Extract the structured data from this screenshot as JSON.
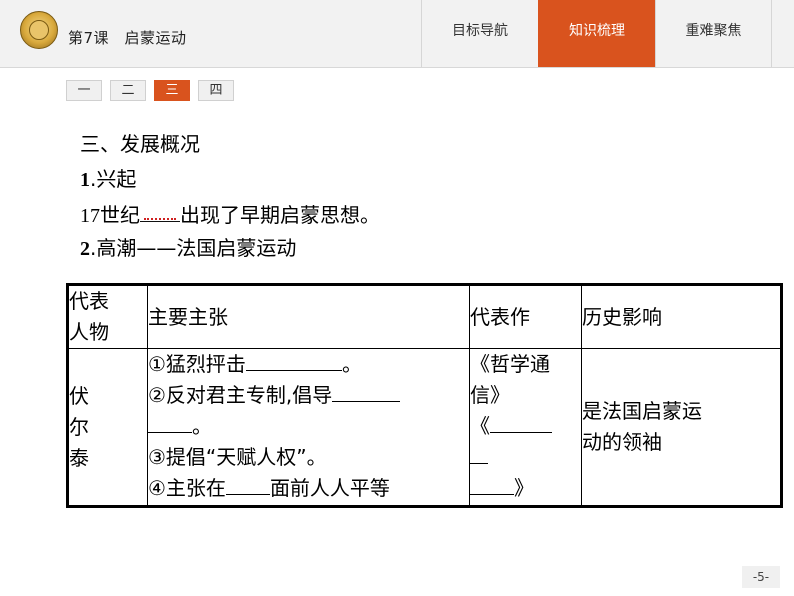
{
  "header": {
    "lesson_title": "第7课　启蒙运动",
    "nav_tabs": [
      {
        "label": "目标导航"
      },
      {
        "label": "知识梳理"
      },
      {
        "label": "重难聚焦"
      }
    ],
    "active_tab": "知识梳理",
    "accent_color": "#d9531e"
  },
  "section_tabs": [
    {
      "label": "一"
    },
    {
      "label": "二"
    },
    {
      "label": "三"
    },
    {
      "label": "四"
    }
  ],
  "content": {
    "heading": "三、发展概况",
    "sub1_num": "1",
    "sub1_text": ".兴起",
    "line1_prefix": "17世纪",
    "line1_suffix": "出现了早期启蒙思想。",
    "sub2_num": "2",
    "sub2_text": ".高潮——法国启蒙运动"
  },
  "table": {
    "headers": {
      "col1_line1": "代表",
      "col1_line2": "人物",
      "col2": "主要主张",
      "col3": "代表作",
      "col4": "历史影响"
    },
    "person_chars": [
      "伏",
      "尔",
      "泰"
    ],
    "claims": {
      "c1_prefix": "①猛烈抨击",
      "c1_suffix": "。",
      "c2_prefix": "②反对君主专制,倡导",
      "c2_cont_suffix": "。",
      "c3": "③提倡“天赋人权”。",
      "c4_prefix": "④主张在",
      "c4_suffix": "面前人人平等"
    },
    "works": {
      "w1_line1": "《哲学通",
      "w1_line2": "信》",
      "w2_open": "《",
      "w2_close": "》"
    },
    "influence": {
      "line1": "是法国启蒙运",
      "line2": "动的领袖"
    }
  },
  "footer": {
    "page_number": "-5-"
  }
}
